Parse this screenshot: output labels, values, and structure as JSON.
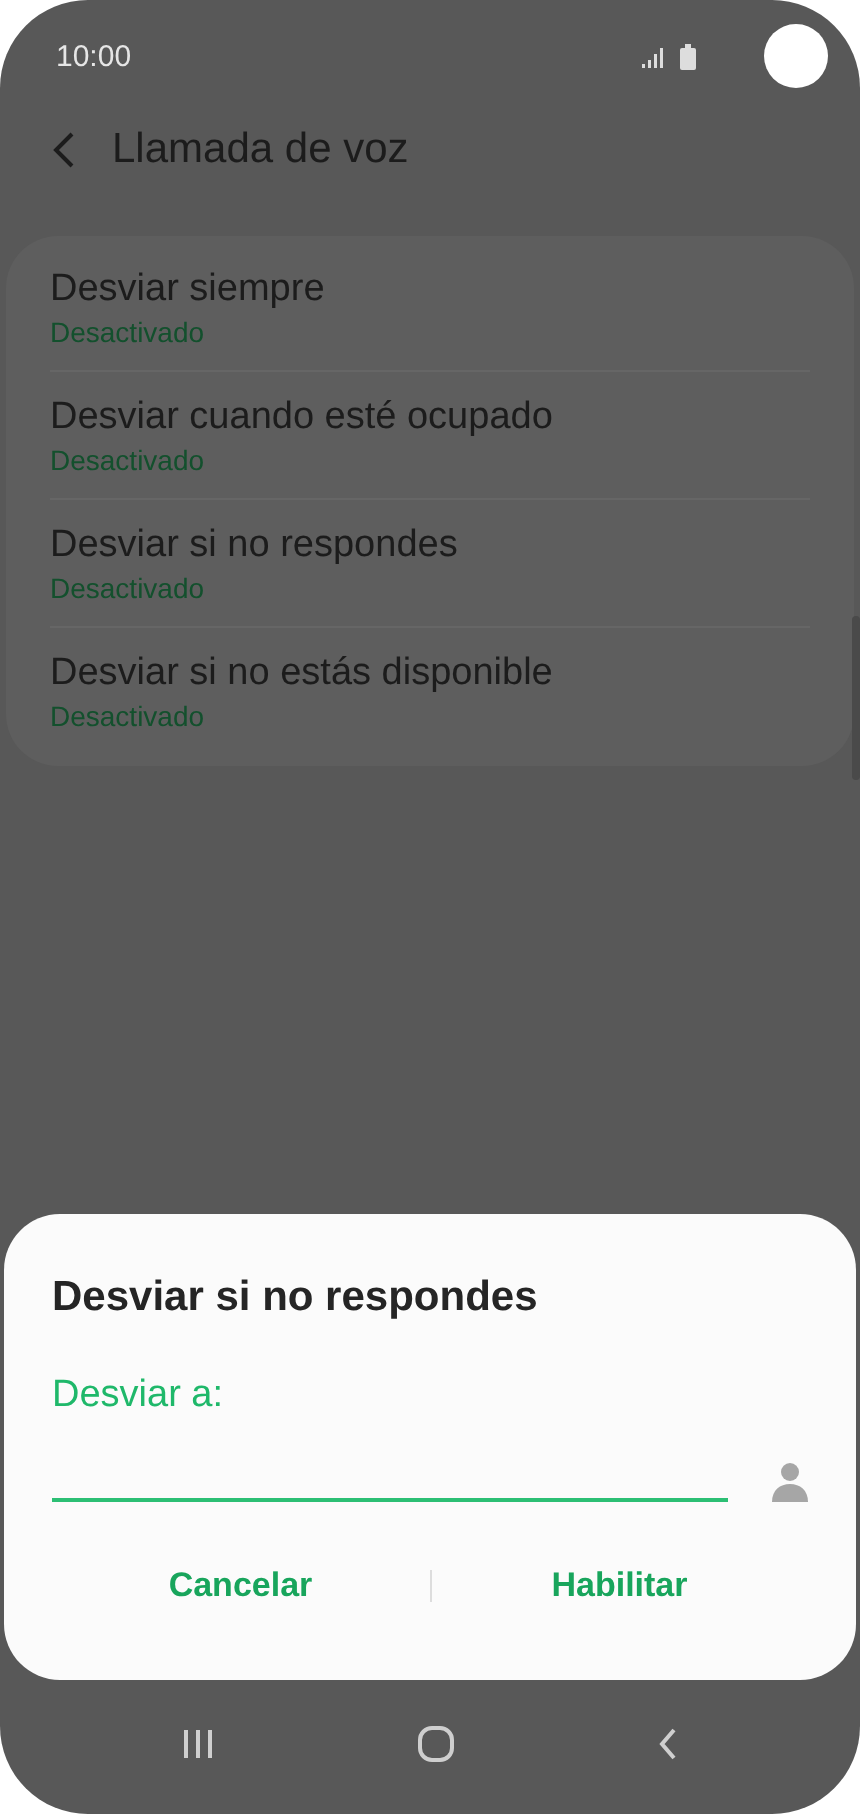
{
  "status_bar": {
    "time": "10:00"
  },
  "header": {
    "title": "Llamada de voz"
  },
  "items": [
    {
      "title": "Desviar siempre",
      "status": "Desactivado"
    },
    {
      "title": "Desviar cuando esté ocupado",
      "status": "Desactivado"
    },
    {
      "title": "Desviar si no respondes",
      "status": "Desactivado"
    },
    {
      "title": "Desviar si no estás disponible",
      "status": "Desactivado"
    }
  ],
  "dialog": {
    "title": "Desviar si no respondes",
    "field_label": "Desviar a:",
    "buttons": [
      "Cancelar",
      "Habilitar"
    ]
  }
}
